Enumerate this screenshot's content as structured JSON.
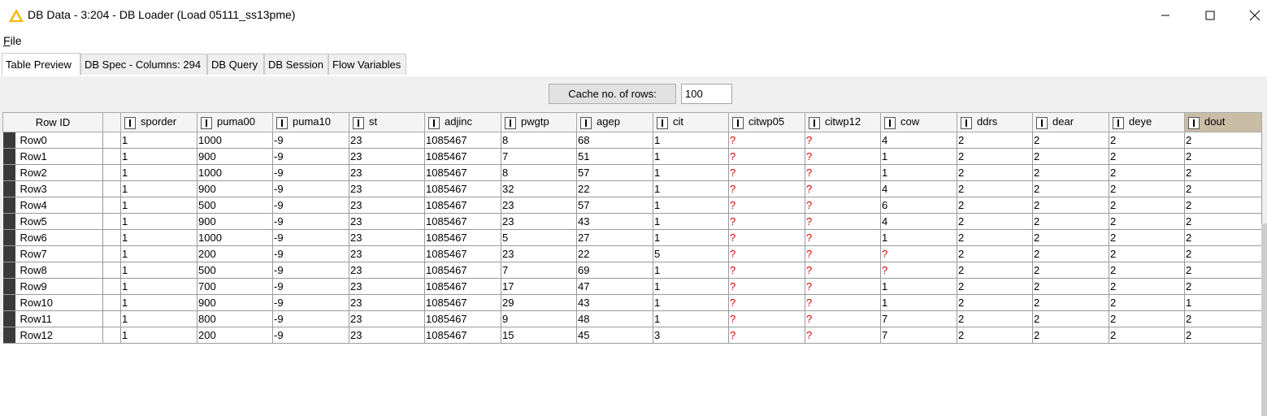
{
  "window": {
    "title": "DB Data - 3:204 - DB Loader (Load  05111_ss13pme)",
    "minimize_icon": "minimize-icon",
    "maximize_icon": "maximize-icon",
    "close_icon": "close-icon",
    "title_icon": "warning-triangle-icon",
    "title_icon_color": "#f5b800"
  },
  "menu": {
    "file_hotkey": "F",
    "file_rest": "ile"
  },
  "tabs": [
    {
      "label": "Table Preview",
      "active": true
    },
    {
      "label": "DB Spec - Columns: 294",
      "active": false
    },
    {
      "label": "DB Query",
      "active": false
    },
    {
      "label": "DB Session",
      "active": false
    },
    {
      "label": "Flow Variables",
      "active": false
    }
  ],
  "cache": {
    "button_label": "Cache no. of rows:",
    "value": "100"
  },
  "table": {
    "rowid_header": "Row ID",
    "columns": [
      "sporder",
      "puma00",
      "puma10",
      "st",
      "adjinc",
      "pwgtp",
      "agep",
      "cit",
      "citwp05",
      "citwp12",
      "cow",
      "ddrs",
      "dear",
      "deye",
      "dout"
    ],
    "rows": [
      {
        "id": "Row0",
        "cells": [
          "1",
          "1000",
          "-9",
          "23",
          "1085467",
          "8",
          "68",
          "1",
          "?",
          "?",
          "4",
          "2",
          "2",
          "2",
          "2"
        ]
      },
      {
        "id": "Row1",
        "cells": [
          "1",
          "900",
          "-9",
          "23",
          "1085467",
          "7",
          "51",
          "1",
          "?",
          "?",
          "1",
          "2",
          "2",
          "2",
          "2"
        ]
      },
      {
        "id": "Row2",
        "cells": [
          "1",
          "1000",
          "-9",
          "23",
          "1085467",
          "8",
          "57",
          "1",
          "?",
          "?",
          "1",
          "2",
          "2",
          "2",
          "2"
        ]
      },
      {
        "id": "Row3",
        "cells": [
          "1",
          "900",
          "-9",
          "23",
          "1085467",
          "32",
          "22",
          "1",
          "?",
          "?",
          "4",
          "2",
          "2",
          "2",
          "2"
        ]
      },
      {
        "id": "Row4",
        "cells": [
          "1",
          "500",
          "-9",
          "23",
          "1085467",
          "23",
          "57",
          "1",
          "?",
          "?",
          "6",
          "2",
          "2",
          "2",
          "2"
        ]
      },
      {
        "id": "Row5",
        "cells": [
          "1",
          "900",
          "-9",
          "23",
          "1085467",
          "23",
          "43",
          "1",
          "?",
          "?",
          "4",
          "2",
          "2",
          "2",
          "2"
        ]
      },
      {
        "id": "Row6",
        "cells": [
          "1",
          "1000",
          "-9",
          "23",
          "1085467",
          "5",
          "27",
          "1",
          "?",
          "?",
          "1",
          "2",
          "2",
          "2",
          "2"
        ]
      },
      {
        "id": "Row7",
        "cells": [
          "1",
          "200",
          "-9",
          "23",
          "1085467",
          "23",
          "22",
          "5",
          "?",
          "?",
          "?",
          "2",
          "2",
          "2",
          "2"
        ]
      },
      {
        "id": "Row8",
        "cells": [
          "1",
          "500",
          "-9",
          "23",
          "1085467",
          "7",
          "69",
          "1",
          "?",
          "?",
          "?",
          "2",
          "2",
          "2",
          "2"
        ]
      },
      {
        "id": "Row9",
        "cells": [
          "1",
          "700",
          "-9",
          "23",
          "1085467",
          "17",
          "47",
          "1",
          "?",
          "?",
          "1",
          "2",
          "2",
          "2",
          "2"
        ]
      },
      {
        "id": "Row10",
        "cells": [
          "1",
          "900",
          "-9",
          "23",
          "1085467",
          "29",
          "43",
          "1",
          "?",
          "?",
          "1",
          "2",
          "2",
          "2",
          "1"
        ]
      },
      {
        "id": "Row11",
        "cells": [
          "1",
          "800",
          "-9",
          "23",
          "1085467",
          "9",
          "48",
          "1",
          "?",
          "?",
          "7",
          "2",
          "2",
          "2",
          "2"
        ]
      },
      {
        "id": "Row12",
        "cells": [
          "1",
          "200",
          "-9",
          "23",
          "1085467",
          "15",
          "45",
          "3",
          "?",
          "?",
          "7",
          "2",
          "2",
          "2",
          "2"
        ]
      }
    ],
    "missing_color": "#e00000",
    "selected_header_color": "#c9bda6"
  }
}
